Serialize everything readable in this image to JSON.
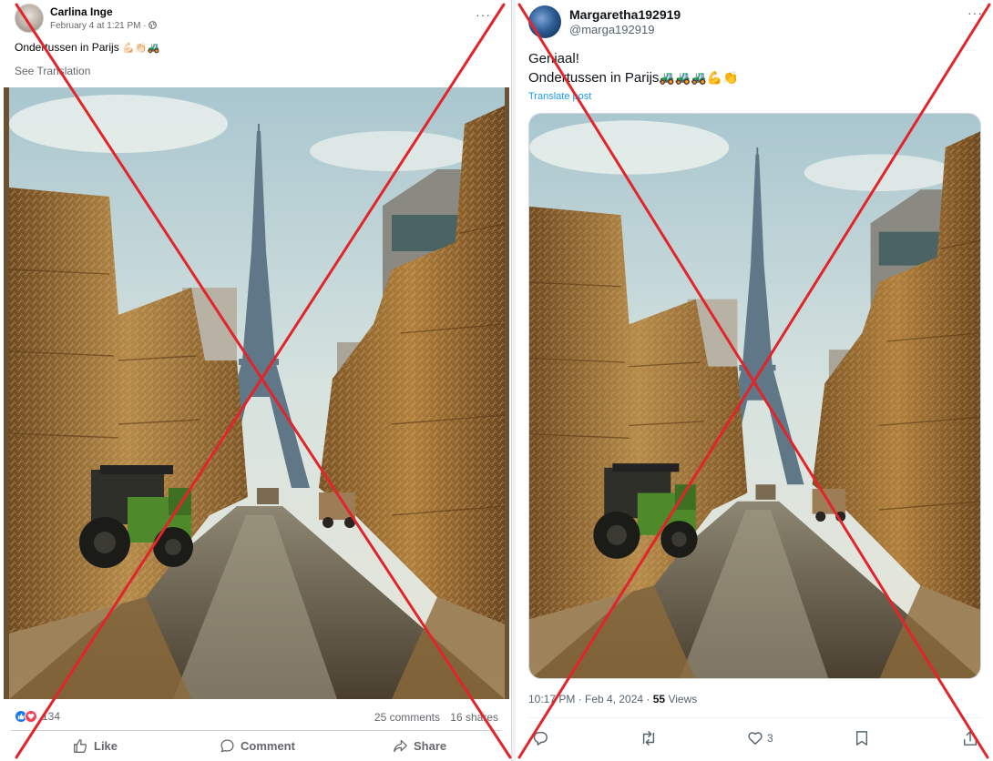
{
  "facebook": {
    "author": "Carlina Inge",
    "timestamp": "February 4 at 1:21 PM · ",
    "audience_icon": "globe-icon",
    "more_label": "···",
    "post_text": "Ondertussen in Parijs",
    "post_emoji": "💪🏻👏🏻🚜",
    "see_translation": "See Translation",
    "reaction_icons": [
      "like-reaction-icon",
      "love-reaction-icon"
    ],
    "reaction_count": "134",
    "comments": "25 comments",
    "shares": "16 shares",
    "actions": {
      "like": "Like",
      "comment": "Comment",
      "share": "Share"
    }
  },
  "twitter": {
    "display_name": "Margaretha192919",
    "handle": "@marga192919",
    "more_label": "···",
    "line1": "Geniaal!",
    "line2": "Ondertussen in Parijs",
    "line2_emoji": "🚜🚜🚜💪👏",
    "translate": "Translate post",
    "time_date": "10:17 PM · Feb 4, 2024 · ",
    "views_count": "55",
    "views_label": " Views",
    "likes": "3"
  },
  "overlay": {
    "cross_color": "#e0252b"
  }
}
